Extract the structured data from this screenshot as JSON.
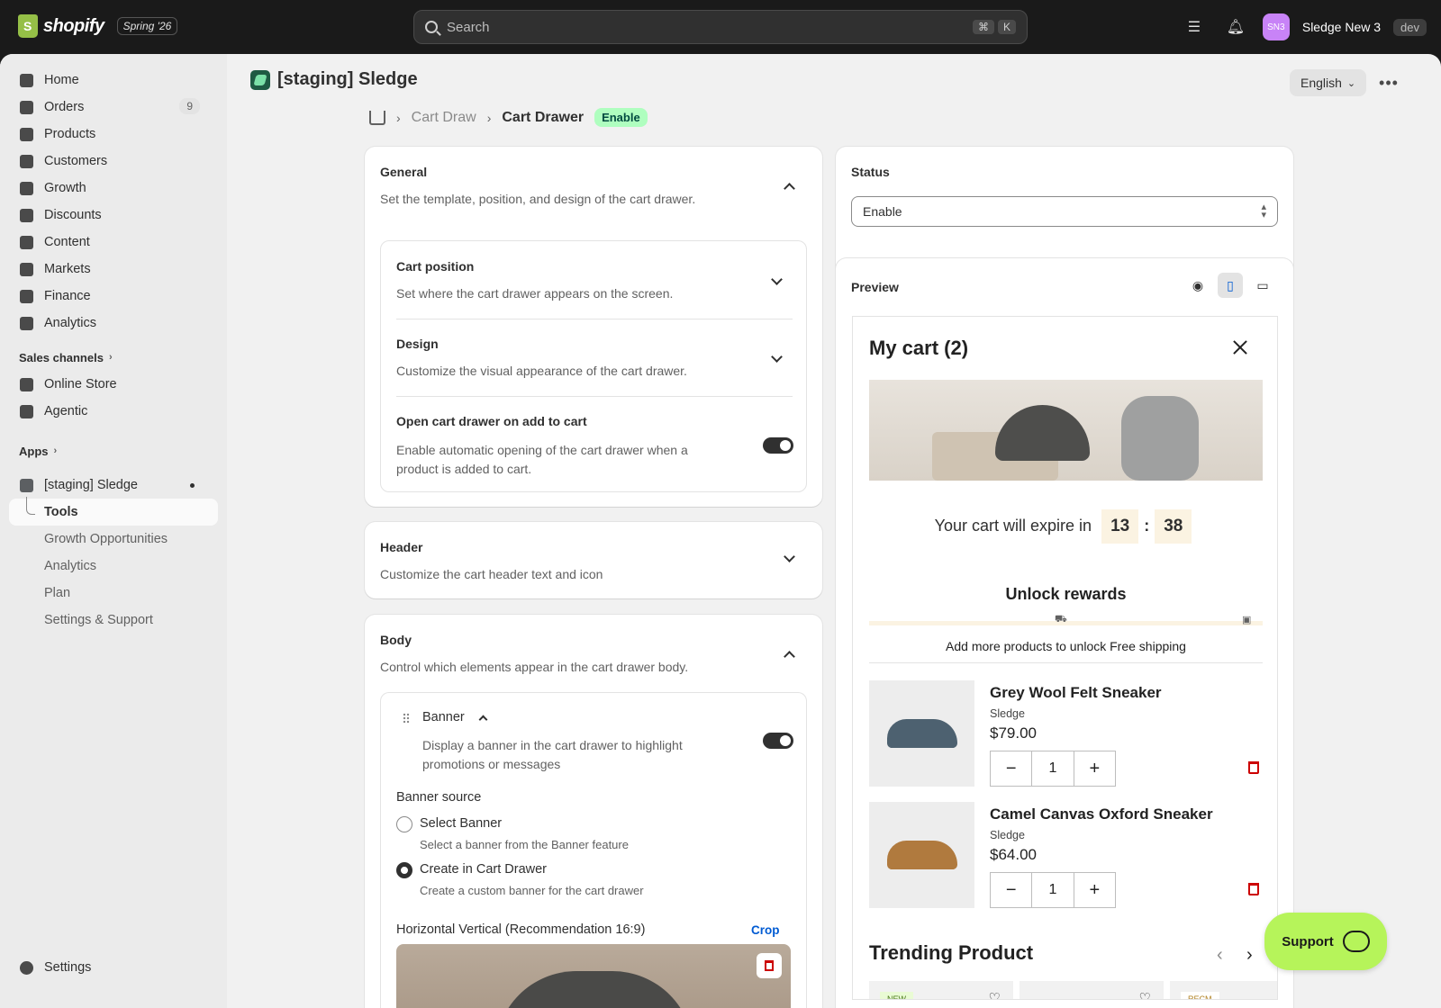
{
  "topbar": {
    "brand": "shopify",
    "edition": "Spring '26",
    "search_placeholder": "Search",
    "shortcut_keys": [
      "⌘",
      "K"
    ],
    "avatar_initials": "SN3",
    "store_name": "Sledge New 3",
    "store_tag": "dev"
  },
  "sidebar": {
    "items": [
      {
        "label": "Home",
        "icon": "home-icon"
      },
      {
        "label": "Orders",
        "icon": "orders-icon",
        "badge": "9"
      },
      {
        "label": "Products",
        "icon": "tag-icon"
      },
      {
        "label": "Customers",
        "icon": "person-icon"
      },
      {
        "label": "Growth",
        "icon": "growth-icon"
      },
      {
        "label": "Discounts",
        "icon": "discount-icon"
      },
      {
        "label": "Content",
        "icon": "content-icon"
      },
      {
        "label": "Markets",
        "icon": "globe-icon"
      },
      {
        "label": "Finance",
        "icon": "bank-icon"
      },
      {
        "label": "Analytics",
        "icon": "bar-chart-icon"
      }
    ],
    "sales_channels_label": "Sales channels",
    "channels": [
      {
        "label": "Online Store",
        "icon": "store-icon"
      },
      {
        "label": "Agentic",
        "icon": "agent-icon"
      }
    ],
    "apps_label": "Apps",
    "app_name": "[staging] Sledge",
    "app_sub": [
      "Tools",
      "Growth Opportunities",
      "Analytics",
      "Plan",
      "Settings & Support"
    ],
    "settings_label": "Settings"
  },
  "page": {
    "app_title": "[staging] Sledge",
    "language": "English",
    "crumbs": {
      "parent": "Cart Draw",
      "current": "Cart Drawer",
      "status_badge": "Enable"
    }
  },
  "general": {
    "title": "General",
    "desc": "Set the template, position, and design of the cart drawer.",
    "cart_position": {
      "title": "Cart position",
      "desc": "Set where the cart drawer appears on the screen."
    },
    "design": {
      "title": "Design",
      "desc": "Customize the visual appearance of the cart drawer."
    },
    "open_on_add": {
      "title": "Open cart drawer on add to cart",
      "desc": "Enable automatic opening of the cart drawer when a product is added to cart.",
      "enabled": true
    }
  },
  "header_card": {
    "title": "Header",
    "desc": "Customize the cart header text and icon"
  },
  "body_card": {
    "title": "Body",
    "desc": "Control which elements appear in the cart drawer body.",
    "banner": {
      "title": "Banner",
      "desc": "Display a banner in the cart drawer to highlight promotions or messages",
      "enabled": true,
      "source_label": "Banner source",
      "options": [
        {
          "label": "Select Banner",
          "help": "Select a banner from the Banner feature",
          "selected": false
        },
        {
          "label": "Create in Cart Drawer",
          "help": "Create a custom banner for the cart drawer",
          "selected": true
        }
      ],
      "image_label": "Horizontal Vertical (Recommendation 16:9)",
      "crop_label": "Crop"
    }
  },
  "status_card": {
    "title": "Status",
    "value": "Enable"
  },
  "preview": {
    "title": "Preview",
    "cart_title": "My cart (2)",
    "expire_text": "Your cart will expire in",
    "timer_min": "13",
    "timer_sep": ":",
    "timer_sec": "38",
    "rewards_title": "Unlock rewards",
    "rewards_progress": 0.0,
    "unlock_text": "Add more products to unlock Free shipping",
    "items": [
      {
        "name": "Grey Wool Felt Sneaker",
        "vendor": "Sledge",
        "price": "$79.00",
        "qty": "1",
        "color": "#4d6170"
      },
      {
        "name": "Camel Canvas Oxford Sneaker",
        "vendor": "Sledge",
        "price": "$64.00",
        "qty": "1",
        "color": "#b07a3e"
      }
    ],
    "trending_title": "Trending Product",
    "trending_badges": [
      "NEW",
      "",
      "RECM"
    ]
  },
  "support_label": "Support"
}
